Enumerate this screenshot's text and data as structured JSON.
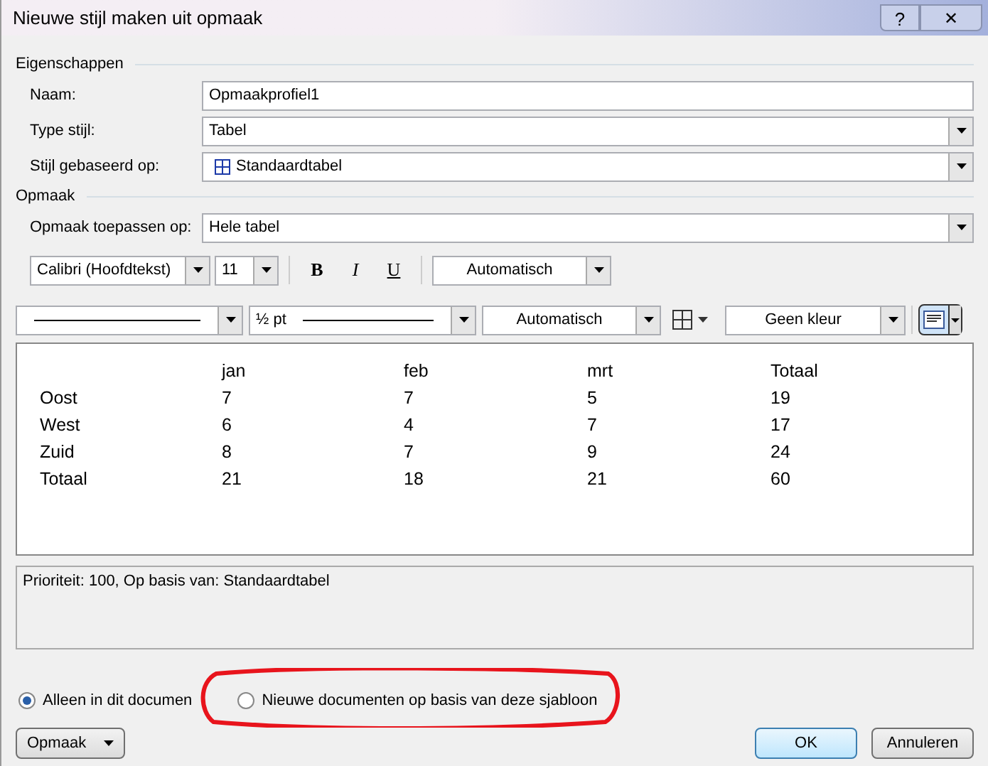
{
  "window": {
    "title": "Nieuwe stijl maken uit opmaak",
    "help_button": "?",
    "close_button": "✕"
  },
  "properties": {
    "legend": "Eigenschappen",
    "fields": [
      {
        "label": "Naam:",
        "kind": "text",
        "value": "Opmaakprofiel1"
      },
      {
        "label": "Type stijl:",
        "kind": "select",
        "value": "Tabel"
      },
      {
        "label": "Stijl gebaseerd op:",
        "kind": "select-icon",
        "value": "Standaardtabel"
      }
    ]
  },
  "format": {
    "legend": "Opmaak",
    "apply_label": "Opmaak toepassen op:",
    "apply_value": "Hele tabel",
    "font": "Calibri (Hoofdtekst)",
    "size": "11",
    "bold": "B",
    "italic": "I",
    "underline": "U",
    "font_color": "Automatisch",
    "border_width": "½ pt",
    "border_color": "Automatisch",
    "shading": "Geen kleur"
  },
  "preview": {
    "columns": [
      "",
      "jan",
      "feb",
      "mrt",
      "Totaal"
    ],
    "rows": [
      [
        "Oost",
        "7",
        "7",
        "5",
        "19"
      ],
      [
        "West",
        "6",
        "4",
        "7",
        "17"
      ],
      [
        "Zuid",
        "8",
        "7",
        "9",
        "24"
      ],
      [
        "Totaal",
        "21",
        "18",
        "21",
        "60"
      ]
    ]
  },
  "description": "Prioriteit: 100, Op basis van: Standaardtabel",
  "scope_options": [
    {
      "label": "Alleen in dit documen",
      "selected": true
    },
    {
      "label": "Nieuwe documenten op basis van deze sjabloon",
      "selected": false
    }
  ],
  "buttons": {
    "format": "Opmaak",
    "ok": "OK",
    "cancel": "Annuleren"
  }
}
